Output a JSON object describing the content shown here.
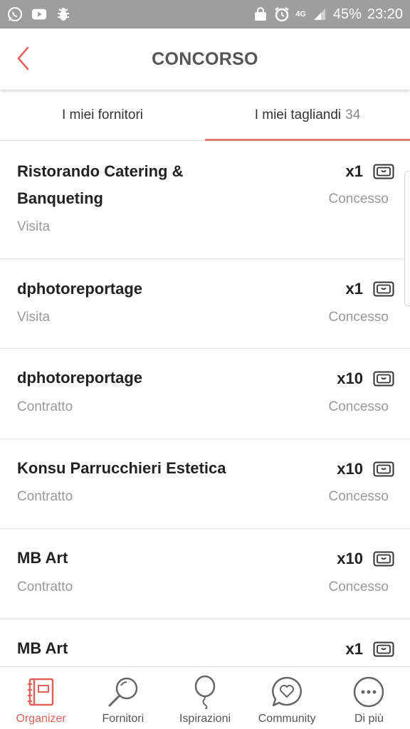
{
  "status_bar": {
    "battery": "45%",
    "time": "23:20",
    "network": "4G"
  },
  "header": {
    "title": "CONCORSO"
  },
  "tabs": [
    {
      "label": "I miei fornitori",
      "count": ""
    },
    {
      "label": "I miei tagliandi",
      "count": "34"
    }
  ],
  "items": [
    {
      "name_line1": "Ristorando Catering &",
      "name_line2": "Banqueting",
      "type": "Visita",
      "qty": "x1",
      "status": "Concesso"
    },
    {
      "name_line1": "dphotoreportage",
      "type": "Visita",
      "qty": "x1",
      "status": "Concesso"
    },
    {
      "name_line1": "dphotoreportage",
      "type": "Contratto",
      "qty": "x10",
      "status": "Concesso"
    },
    {
      "name_line1": "Konsu Parrucchieri Estetica",
      "type": "Contratto",
      "qty": "x10",
      "status": "Concesso"
    },
    {
      "name_line1": "MB Art",
      "type": "Contratto",
      "qty": "x10",
      "status": "Concesso"
    },
    {
      "name_line1": "MB Art",
      "qty": "x1"
    }
  ],
  "bottom_nav": [
    {
      "label": "Organizer",
      "icon": "notebook-icon"
    },
    {
      "label": "Fornitori",
      "icon": "magnifier-icon"
    },
    {
      "label": "Ispirazioni",
      "icon": "balloon-icon"
    },
    {
      "label": "Community",
      "icon": "chat-heart-icon"
    },
    {
      "label": "Di più",
      "icon": "more-icon"
    }
  ],
  "colors": {
    "accent": "#e0605c",
    "status_bar": "#9e9e9e"
  }
}
